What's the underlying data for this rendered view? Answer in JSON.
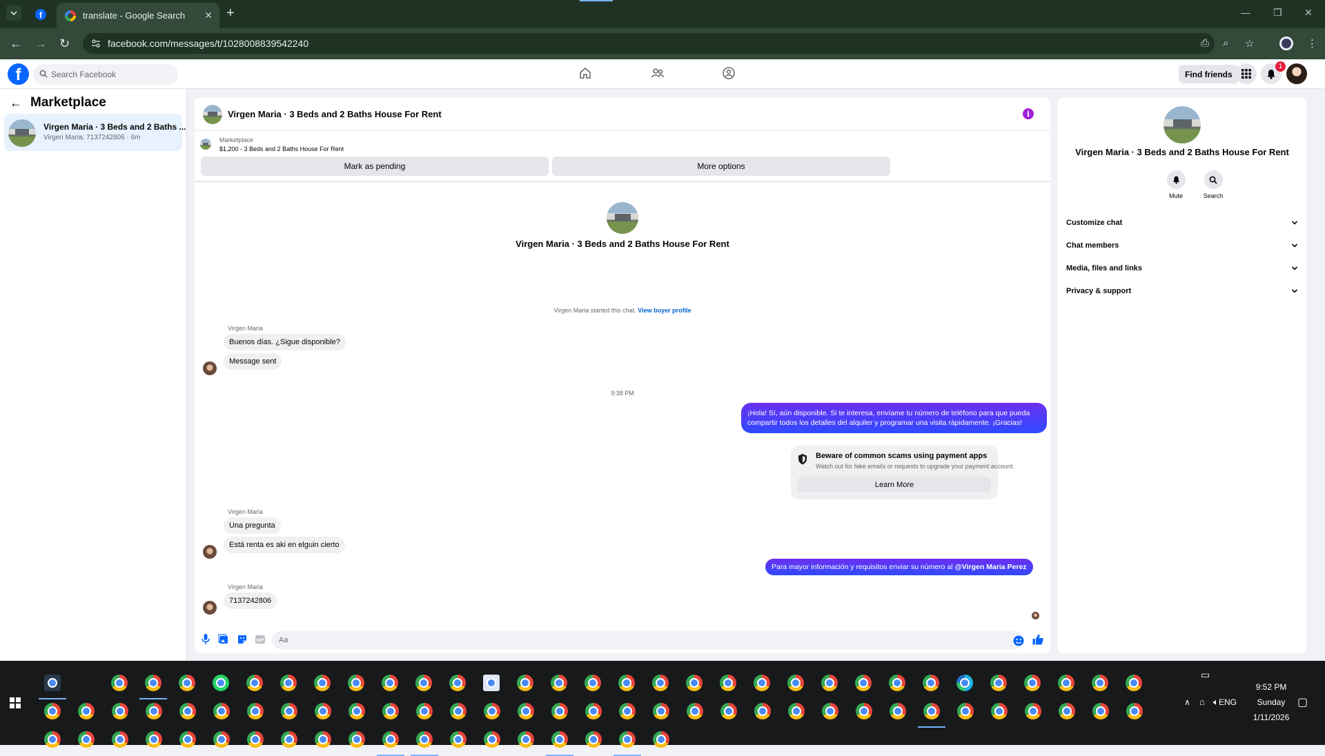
{
  "browser": {
    "tab_title": "translate - Google Search",
    "url": "facebook.com/messages/t/1028008839542240"
  },
  "fb": {
    "search_placeholder": "Search Facebook",
    "find_friends": "Find friends",
    "notification_count": "1"
  },
  "left": {
    "heading": "Marketplace",
    "conversation": {
      "title": "Virgen Maria · 3 Beds and 2 Baths ...",
      "subtitle": "Virgen Maria: 7137242806 · 6m"
    }
  },
  "chat": {
    "title": "Virgen Maria · 3 Beds and 2 Baths House For Rent",
    "listing_label": "Marketplace",
    "listing_price": "$1,200 - 3 Beds and 2 Baths House For Rent",
    "mark_pending": "Mark as pending",
    "more_options": "More options",
    "profile_name": "Virgen Maria · 3 Beds and 2 Baths House For Rent",
    "started_text": "Virgen Maria started this chat.",
    "view_buyer_profile": "View buyer profile",
    "sender": "Virgen Maria",
    "msg1": "Buenos días. ¿Sigue disponible?",
    "msg2": "Message sent",
    "timestamp": "9:38 PM",
    "out1": "¡Hola! Sí, aún disponible. Si te interesa, envíame tu número de teléfono para que pueda compartir todos los detalles del alquiler y programar una visita rápidamente. ¡Gracias!",
    "scam_title": "Beware of common scams using payment apps",
    "scam_sub": "Watch out for fake emails or requests to upgrade your payment account.",
    "learn_more": "Learn More",
    "msg3": "Una pregunta",
    "msg4": "Está renta es aki en elguin cierto",
    "out2_text": "Para mayor información y requisitos enviar su número al",
    "out2_mention": "@Virgen Maria Perez",
    "msg5": "7137242806",
    "composer_placeholder": "Aa"
  },
  "right": {
    "name": "Virgen Maria · 3 Beds and 2 Baths House For Rent",
    "mute": "Mute",
    "search": "Search",
    "sections": [
      "Customize chat",
      "Chat members",
      "Media, files and links",
      "Privacy & support"
    ]
  },
  "tray": {
    "lang": "ENG",
    "time": "9:52 PM",
    "day": "Sunday",
    "date": "1/11/2026"
  }
}
